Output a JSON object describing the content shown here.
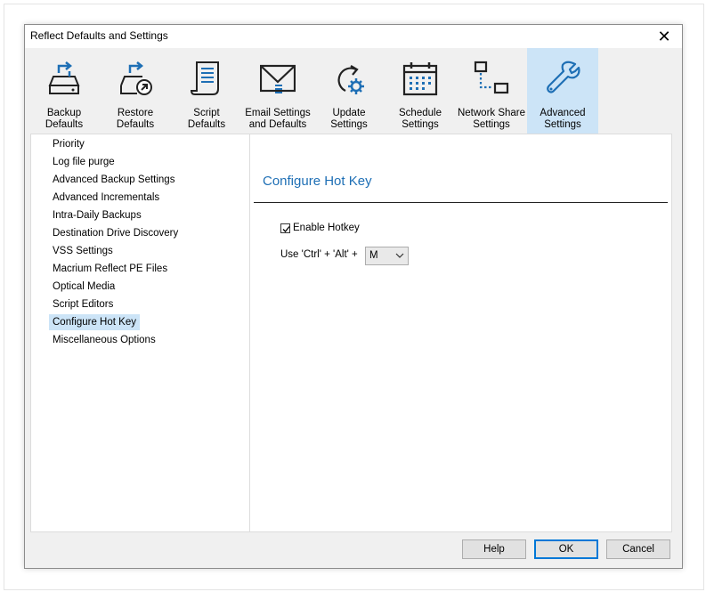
{
  "window": {
    "title": "Reflect Defaults and Settings",
    "close_glyph": "✕"
  },
  "toolbar": {
    "items": [
      {
        "label": "Backup\nDefaults",
        "icon": "backup-icon"
      },
      {
        "label": "Restore\nDefaults",
        "icon": "restore-icon"
      },
      {
        "label": "Script\nDefaults",
        "icon": "script-icon"
      },
      {
        "label": "Email Settings\nand Defaults",
        "icon": "email-icon"
      },
      {
        "label": "Update\nSettings",
        "icon": "update-icon"
      },
      {
        "label": "Schedule\nSettings",
        "icon": "calendar-icon"
      },
      {
        "label": "Network Share\nSettings",
        "icon": "network-icon"
      },
      {
        "label": "Advanced\nSettings",
        "icon": "wrench-icon",
        "active": true
      }
    ]
  },
  "nav": {
    "items": [
      "Priority",
      "Log file purge",
      "Advanced Backup Settings",
      "Advanced Incrementals",
      "Intra-Daily Backups",
      "Destination Drive Discovery",
      "VSS Settings",
      "Macrium Reflect PE Files",
      "Optical Media",
      "Script Editors",
      "Configure Hot Key",
      "Miscellaneous Options"
    ],
    "selected": "Configure Hot Key"
  },
  "panel": {
    "title": "Configure Hot Key",
    "enable_hotkey_label": "Enable Hotkey",
    "enable_hotkey_checked": true,
    "hotkey_prefix": "Use 'Ctrl' + 'Alt' +",
    "hotkey_key": "M"
  },
  "buttons": {
    "help": "Help",
    "ok": "OK",
    "cancel": "Cancel"
  },
  "colors": {
    "accent": "#1e6fb5",
    "selection": "#cce4f7",
    "primary_border": "#0078d7"
  }
}
